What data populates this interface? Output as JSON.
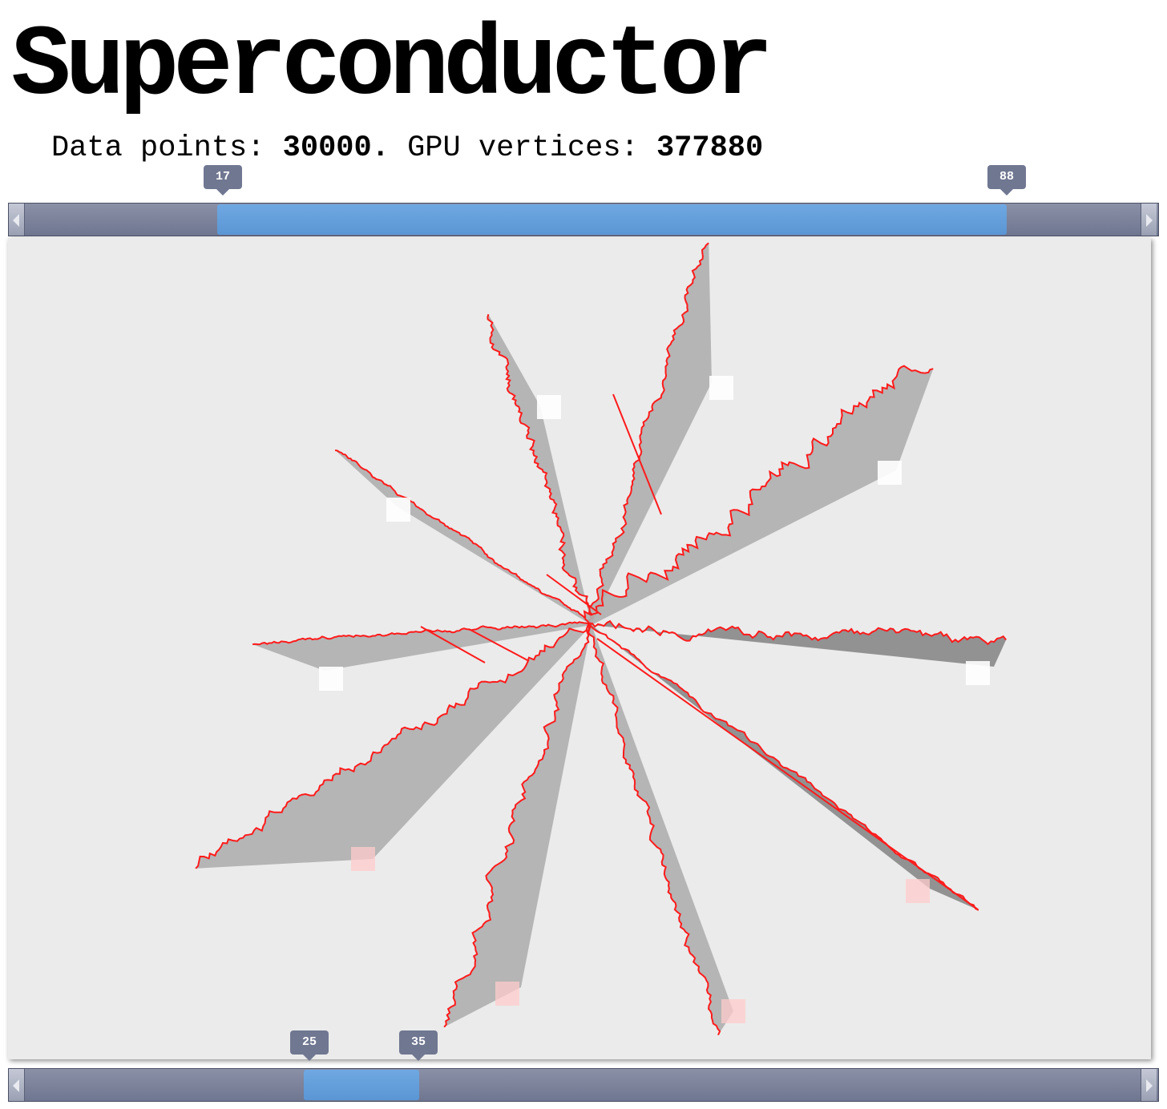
{
  "header": {
    "title": "Superconductor",
    "stats": {
      "label_points": "Data points: ",
      "points": "30000.",
      "label_vertices": " GPU vertices: ",
      "vertices": "377880"
    }
  },
  "top_slider": {
    "min_label": "17",
    "max_label": "88",
    "range": [
      17,
      88
    ],
    "scale_max": 100
  },
  "bottom_slider": {
    "min_label": "25",
    "max_label": "35",
    "range": [
      25,
      35
    ],
    "scale_max": 100
  },
  "colors": {
    "line": "#ff1a1a",
    "fill": "#b0b0b0",
    "fill_dark": "#8a8a8a",
    "background": "#ebebeb",
    "slider_range": "#5f9bd8",
    "slider_track": "#7a8098",
    "white_marker": "#ffffff",
    "pink_marker": "#ffcccc"
  }
}
